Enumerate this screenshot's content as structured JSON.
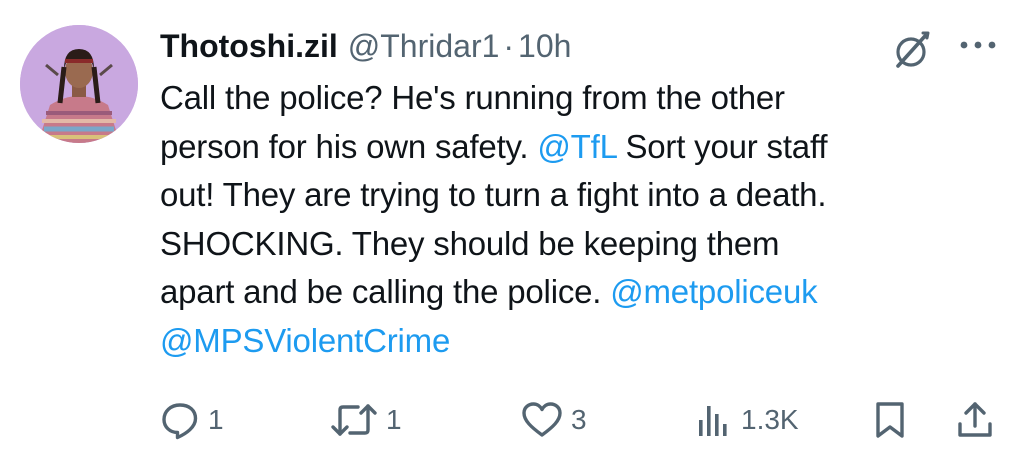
{
  "tweet": {
    "display_name": "Thotoshi.zil",
    "handle": "@Thridar1",
    "separator": "·",
    "time": "10h",
    "text": {
      "line1": "Call the police? He's running from the other",
      "line2_pre": "person for his own safety. ",
      "mention_tfl": "@TfL",
      "line2_post": " Sort your staff",
      "line3": "out! They are trying to turn a fight into a death.",
      "line4": "SHOCKING. They should be keeping them",
      "line5_pre": "apart and be calling the police. ",
      "mention_met": "@metpoliceuk",
      "mention_mps": "@MPSViolentCrime"
    },
    "actions": {
      "reply_count": "1",
      "retweet_count": "1",
      "like_count": "3",
      "views_count": "1.3K"
    }
  },
  "icons": {
    "avatar": "user-avatar",
    "grok": "grok-icon",
    "more": "more-icon",
    "reply": "reply-icon",
    "retweet": "retweet-icon",
    "like": "heart-icon",
    "views": "views-chart-icon",
    "bookmark": "bookmark-icon",
    "share": "share-icon"
  },
  "colors": {
    "text": "#0f1419",
    "secondary": "#536471",
    "link": "#1d9bf0",
    "avatar_bg": "#c9a8e0"
  }
}
